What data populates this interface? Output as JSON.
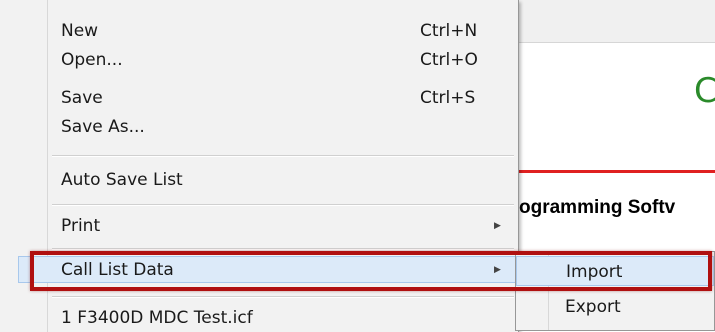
{
  "background_app": {
    "logo_letter": "C",
    "heading": "ogramming Softv"
  },
  "menu": {
    "items": [
      {
        "label": "New",
        "shortcut": "Ctrl+N"
      },
      {
        "label": "Open...",
        "shortcut": "Ctrl+O"
      },
      {
        "label": "Save",
        "shortcut": "Ctrl+S"
      },
      {
        "label": "Save As...",
        "shortcut": ""
      },
      {
        "label": "Auto Save List",
        "shortcut": ""
      },
      {
        "label": "Print",
        "shortcut": "",
        "submenu": true
      },
      {
        "label": "Call List Data",
        "shortcut": "",
        "submenu": true,
        "highlighted": true
      },
      {
        "label": "1 F3400D MDC Test.icf",
        "shortcut": ""
      }
    ],
    "submenu_arrow_icon": "triangle-right-icon"
  },
  "submenu": {
    "items": [
      {
        "label": "Import",
        "highlighted": true
      },
      {
        "label": "Export",
        "highlighted": false
      }
    ]
  },
  "colors": {
    "highlight": "#dceaf9",
    "annotation": "#b01010",
    "logo_green": "#2a8a2a",
    "rule_red": "#e02020"
  }
}
